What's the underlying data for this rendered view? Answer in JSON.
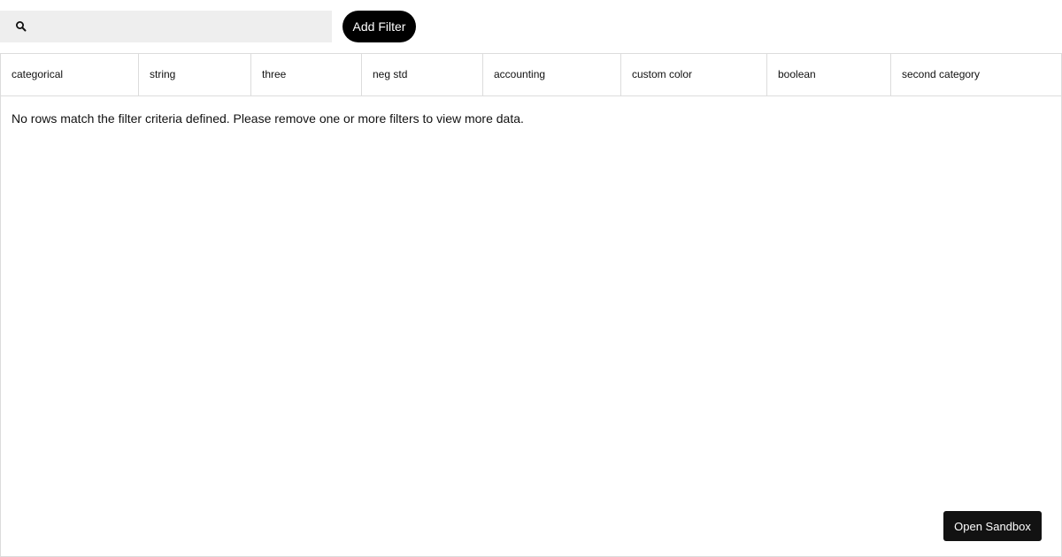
{
  "toolbar": {
    "search": {
      "icon": "search-icon",
      "value": "",
      "placeholder": ""
    },
    "add_filter_label": "Add Filter"
  },
  "grid": {
    "columns": [
      "categorical",
      "string",
      "three",
      "neg std",
      "accounting",
      "custom color",
      "boolean",
      "second category"
    ],
    "empty_message": "No rows match the filter criteria defined. Please remove one or more filters to view more data."
  },
  "footer": {
    "open_sandbox_label": "Open Sandbox"
  }
}
